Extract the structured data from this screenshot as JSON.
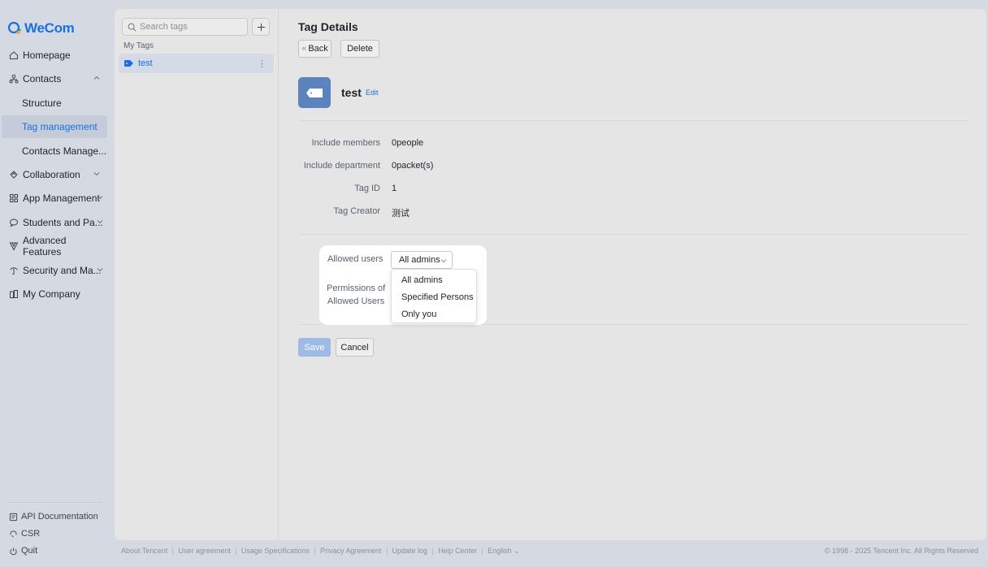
{
  "brand": {
    "name": "WeCom",
    "color": "#1a6fe0"
  },
  "nav": {
    "items": [
      {
        "label": "Homepage",
        "icon": "home-icon"
      },
      {
        "label": "Contacts",
        "icon": "contacts-icon",
        "expanded": true
      },
      {
        "label": "Structure"
      },
      {
        "label": "Tag management",
        "active": true
      },
      {
        "label": "Contacts Manage..."
      },
      {
        "label": "Collaboration",
        "icon": "collaboration-icon"
      },
      {
        "label": "App Management",
        "icon": "app-grid-icon"
      },
      {
        "label": "Students and Pa...",
        "icon": "chat-bubble-icon"
      },
      {
        "label": "Advanced Features",
        "icon": "advanced-icon"
      },
      {
        "label": "Security and Ma...",
        "icon": "security-icon"
      },
      {
        "label": "My Company",
        "icon": "company-icon"
      }
    ],
    "footer": [
      {
        "label": "API Documentation",
        "icon": "document-icon"
      },
      {
        "label": "CSR",
        "icon": "csr-icon"
      },
      {
        "label": "Quit",
        "icon": "power-icon"
      }
    ]
  },
  "tag_list": {
    "search_placeholder": "Search tags",
    "section_label": "My Tags",
    "tags": [
      {
        "name": "test"
      }
    ]
  },
  "detail": {
    "title": "Tag Details",
    "back_label": "Back",
    "delete_label": "Delete",
    "tag_name": "test",
    "edit_label": "Edit",
    "info": [
      {
        "label": "Include members",
        "value": "0people"
      },
      {
        "label": "Include department",
        "value": "0packet(s)"
      },
      {
        "label": "Tag ID",
        "value": "1"
      },
      {
        "label": "Tag Creator",
        "value": "测试"
      }
    ],
    "allowed_users_label": "Allowed users",
    "allowed_users_value": "All admins",
    "permissions_label_line1": "Permissions of",
    "permissions_label_line2": "Allowed Users",
    "dropdown_options": [
      "All admins",
      "Specified Persons",
      "Only you"
    ],
    "save_label": "Save",
    "cancel_label": "Cancel"
  },
  "footer": {
    "links": [
      "About Tencent",
      "User agreement",
      "Usage Specifications",
      "Privacy Agreement",
      "Update log",
      "Help Center",
      "English"
    ],
    "copyright": "© 1998 - 2025 Tencent Inc. All Rights Reserved"
  }
}
